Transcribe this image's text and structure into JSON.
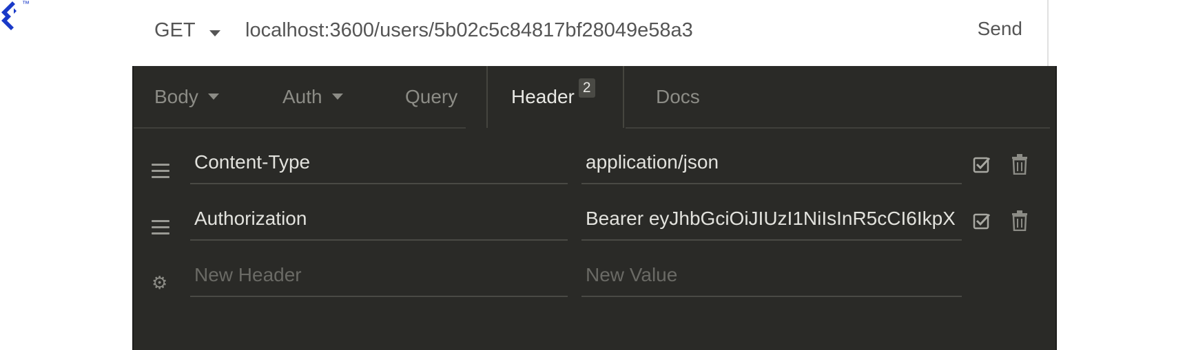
{
  "logo": {
    "name": "Toptal",
    "trademark": "™",
    "color": "#1a3ac8"
  },
  "request": {
    "method": "GET",
    "url": "localhost:3600/users/5b02c5c84817bf28049e58a3",
    "send_label": "Send"
  },
  "tabs": [
    {
      "label": "Body",
      "dropdown": true,
      "active": false
    },
    {
      "label": "Auth",
      "dropdown": true,
      "active": false
    },
    {
      "label": "Query",
      "dropdown": false,
      "active": false
    },
    {
      "label": "Header",
      "badge": "2",
      "active": true
    },
    {
      "label": "Docs",
      "dropdown": false,
      "active": false
    }
  ],
  "headers": [
    {
      "name": "Content-Type",
      "value": "application/json",
      "enabled": true
    },
    {
      "name": "Authorization",
      "value": "Bearer eyJhbGciOiJIUzI1NiIsInR5cCI6IkpX",
      "enabled": true
    }
  ],
  "new_header": {
    "name_placeholder": "New Header",
    "value_placeholder": "New Value"
  },
  "colors": {
    "panel_bg": "#2a2a27",
    "accent_logo": "#1a3ac8"
  }
}
